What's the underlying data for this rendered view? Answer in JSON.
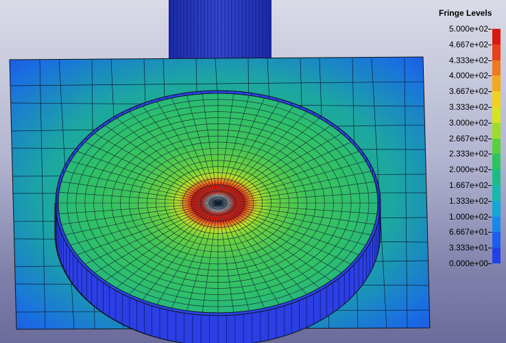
{
  "legend": {
    "title": "Fringe Levels",
    "levels": [
      "5.000e+02",
      "4.667e+02",
      "4.333e+02",
      "4.000e+02",
      "3.667e+02",
      "3.333e+02",
      "3.000e+02",
      "2.667e+02",
      "2.333e+02",
      "2.000e+02",
      "1.667e+02",
      "1.333e+02",
      "1.000e+02",
      "6.667e+01",
      "3.333e+01",
      "0.000e+00"
    ],
    "colors": [
      "#d81a0f",
      "#e8401a",
      "#f0781e",
      "#f4a820",
      "#f2d01e",
      "#d6e41e",
      "#9fdc2a",
      "#5ad03c",
      "#2ec45c",
      "#1cbc86",
      "#16b8b0",
      "#14a6d6",
      "#1688ec",
      "#1c5ef0",
      "#2040e8"
    ],
    "outside_color": "#aaaaaa"
  },
  "model": {
    "plate_color": "#1f5fe0",
    "wall_color": "#2a3ae6",
    "stem_color": "#2333c0",
    "center_color": "#c8c8c8"
  }
}
